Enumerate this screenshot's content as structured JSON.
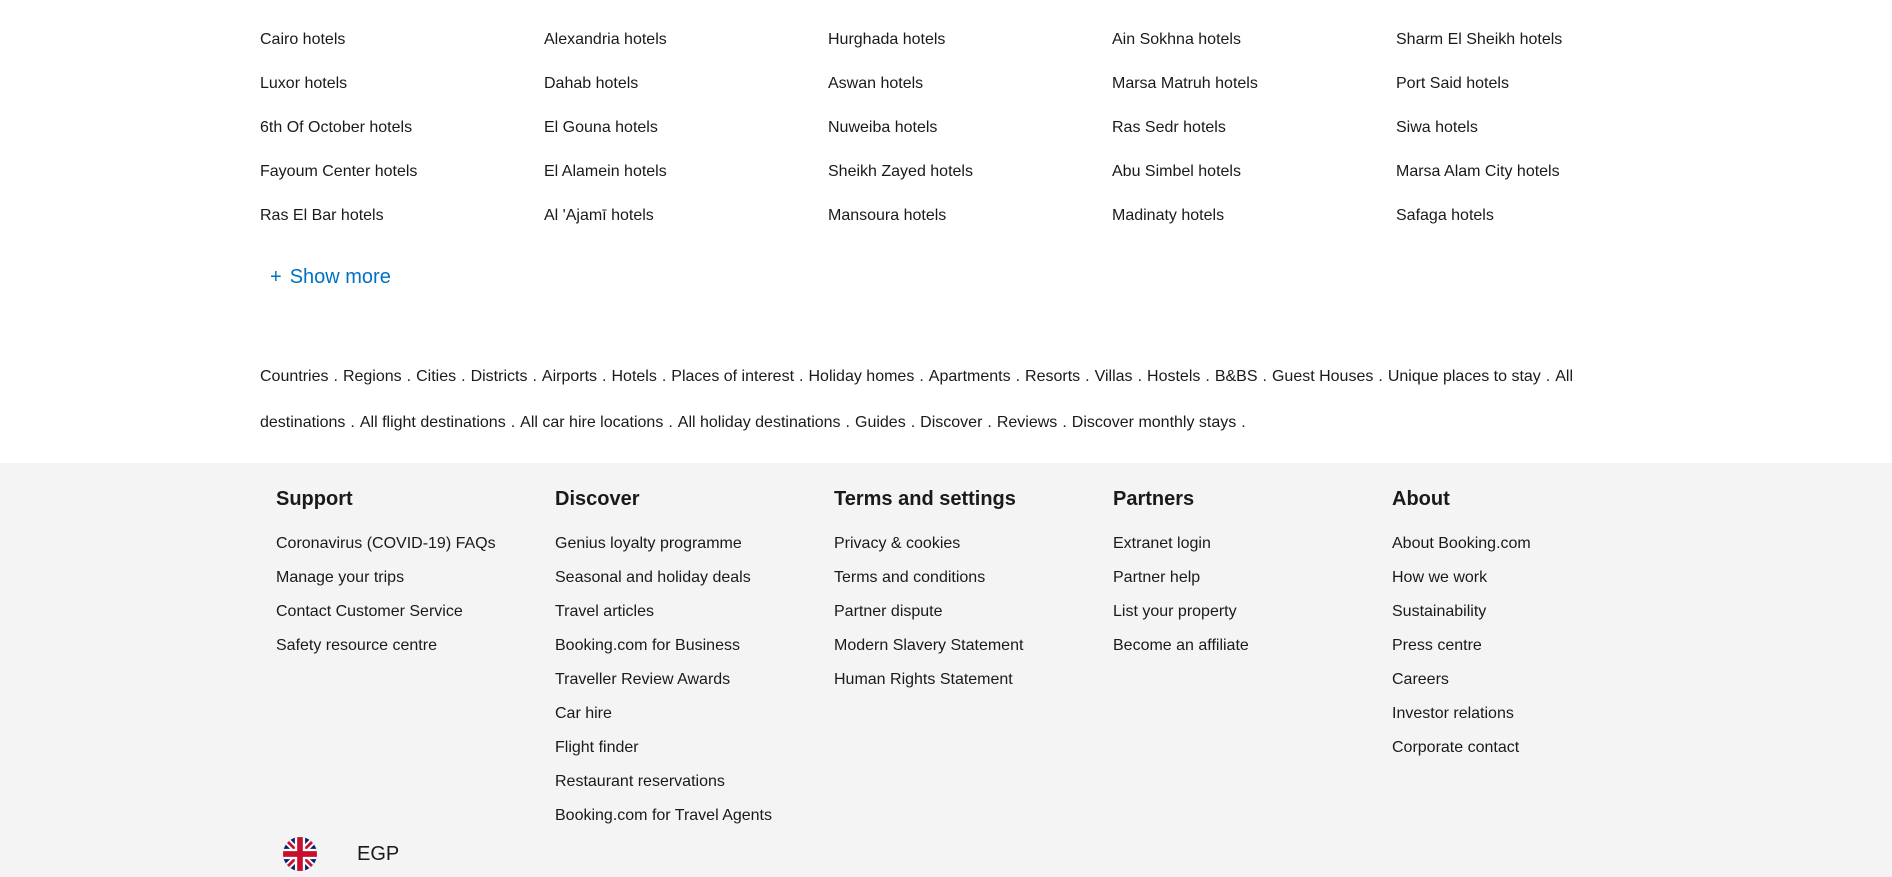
{
  "hotels": {
    "rows": [
      [
        "Cairo hotels",
        "Alexandria hotels",
        "Hurghada hotels",
        "Ain Sokhna hotels",
        "Sharm El Sheikh hotels"
      ],
      [
        "Luxor hotels",
        "Dahab hotels",
        "Aswan hotels",
        "Marsa Matruh hotels",
        "Port Said hotels"
      ],
      [
        "6th Of October hotels",
        "El Gouna hotels",
        "Nuweiba hotels",
        "Ras Sedr hotels",
        "Siwa hotels"
      ],
      [
        "Fayoum Center hotels",
        "El Alamein hotels",
        "Sheikh Zayed hotels",
        "Abu Simbel hotels",
        "Marsa Alam City hotels"
      ],
      [
        "Ras El Bar hotels",
        "Al 'Ajamī hotels",
        "Mansoura hotels",
        "Madinaty hotels",
        "Safaga hotels"
      ]
    ],
    "show_more": {
      "plus": "+",
      "label": "Show more"
    }
  },
  "destinations": {
    "links": [
      "Countries",
      "Regions",
      "Cities",
      "Districts",
      "Airports",
      "Hotels",
      "Places of interest",
      "Holiday homes",
      "Apartments",
      "Resorts",
      "Villas",
      "Hostels",
      "B&BS",
      "Guest Houses",
      "Unique places to stay",
      "All destinations",
      "All flight destinations",
      "All car hire locations",
      "All holiday destinations",
      "Guides",
      "Discover",
      "Reviews",
      "Discover monthly stays"
    ],
    "separator": "."
  },
  "footer": {
    "columns": [
      {
        "title": "Support",
        "links": [
          "Coronavirus (COVID-19) FAQs",
          "Manage your trips",
          "Contact Customer Service",
          "Safety resource centre"
        ]
      },
      {
        "title": "Discover",
        "links": [
          "Genius loyalty programme",
          "Seasonal and holiday deals",
          "Travel articles",
          "Booking.com for Business",
          "Traveller Review Awards",
          "Car hire",
          "Flight finder",
          "Restaurant reservations",
          "Booking.com for Travel Agents"
        ]
      },
      {
        "title": "Terms and settings",
        "links": [
          "Privacy & cookies",
          "Terms and conditions",
          "Partner dispute",
          "Modern Slavery Statement",
          "Human Rights Statement"
        ]
      },
      {
        "title": "Partners",
        "links": [
          "Extranet login",
          "Partner help",
          "List your property",
          "Become an affiliate"
        ]
      },
      {
        "title": "About",
        "links": [
          "About Booking.com",
          "How we work",
          "Sustainability",
          "Press centre",
          "Careers",
          "Investor relations",
          "Corporate contact"
        ]
      }
    ],
    "language_icon": "uk-flag-icon",
    "currency": "EGP"
  },
  "colors": {
    "link_blue": "#0071c2",
    "footer_bg": "#f4f4f4",
    "text": "#1a1a1a"
  }
}
